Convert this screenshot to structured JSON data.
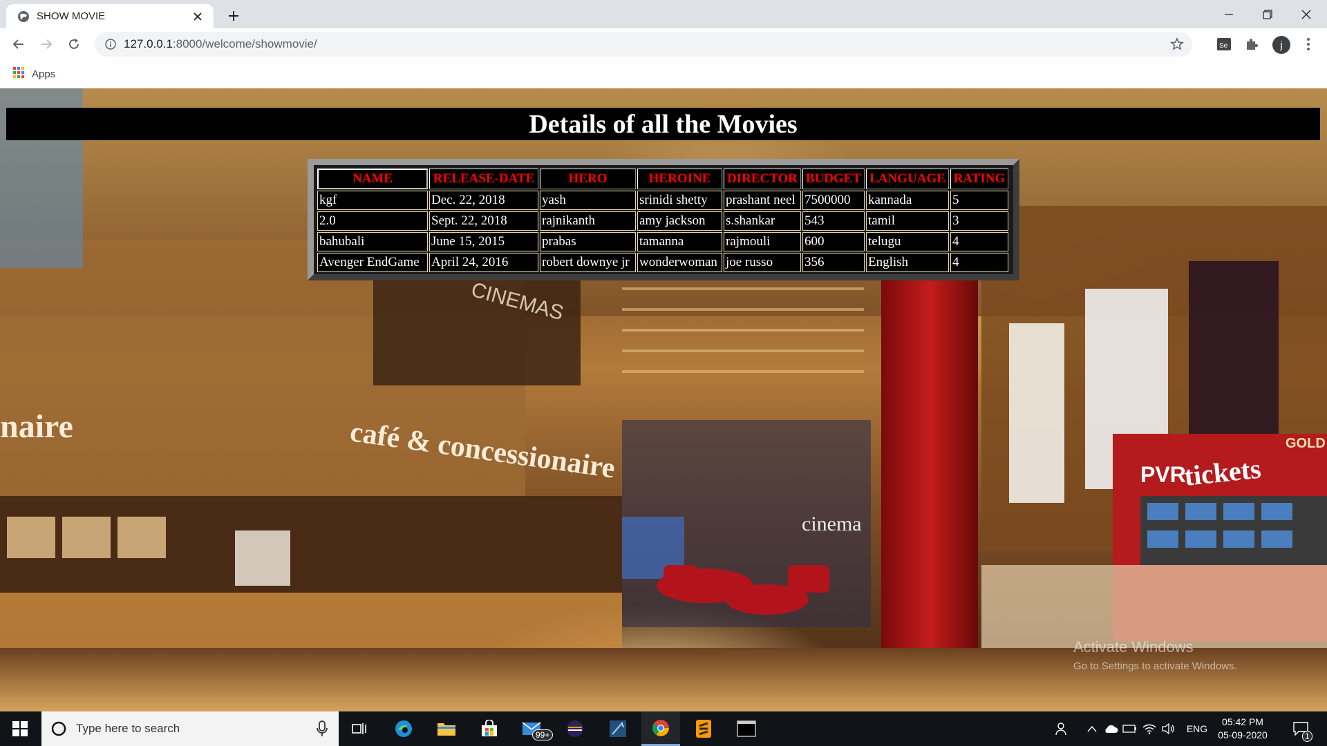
{
  "browser": {
    "tab_title": "SHOW MOVIE",
    "url_host": "127.0.0.1",
    "url_path": ":8000/welcome/showmovie/",
    "bookmarks_apps_label": "Apps",
    "profile_initial": "j"
  },
  "page": {
    "heading": "Details of all the Movies",
    "table": {
      "headers": [
        "NAME",
        "RELEASE-DATE",
        "HERO",
        "HEROINE",
        "DIRECTOR",
        "BUDGET",
        "LANGUAGE",
        "RATING"
      ],
      "rows": [
        [
          "kgf",
          "Dec. 22, 2018",
          "yash",
          "srinidi shetty",
          "prashant neel",
          "7500000",
          "kannada",
          "5"
        ],
        [
          "2.0",
          "Sept. 22, 2018",
          "rajnikanth",
          "amy jackson",
          "s.shankar",
          "543",
          "tamil",
          "3"
        ],
        [
          "bahubali",
          "June 15, 2015",
          "prabas",
          "tamanna",
          "rajmouli",
          "600",
          "telugu",
          "4"
        ],
        [
          "Avenger EndGame",
          "April 24, 2016",
          "robert downye jr",
          "wonderwoman",
          "joe russo",
          "356",
          "English",
          "4"
        ]
      ]
    },
    "background_signage": {
      "naire": "naire",
      "cafe": "café & concessionaire",
      "cinemas": "CINEMAS",
      "cinema": "cinema",
      "pvr": "PVR",
      "tickets": "tickets",
      "gold_class": "GOLD CLAS"
    },
    "watermark": {
      "line1": "Activate Windows",
      "line2": "Go to Settings to activate Windows."
    }
  },
  "taskbar": {
    "search_placeholder": "Type here to search",
    "mail_badge": "99+",
    "language": "ENG",
    "time": "05:42 PM",
    "date": "05-09-2020",
    "notification_count": "1"
  },
  "colors": {
    "header_text": "#ff0000",
    "heading_bg": "#000000",
    "table_border": "#e8d9a8"
  }
}
